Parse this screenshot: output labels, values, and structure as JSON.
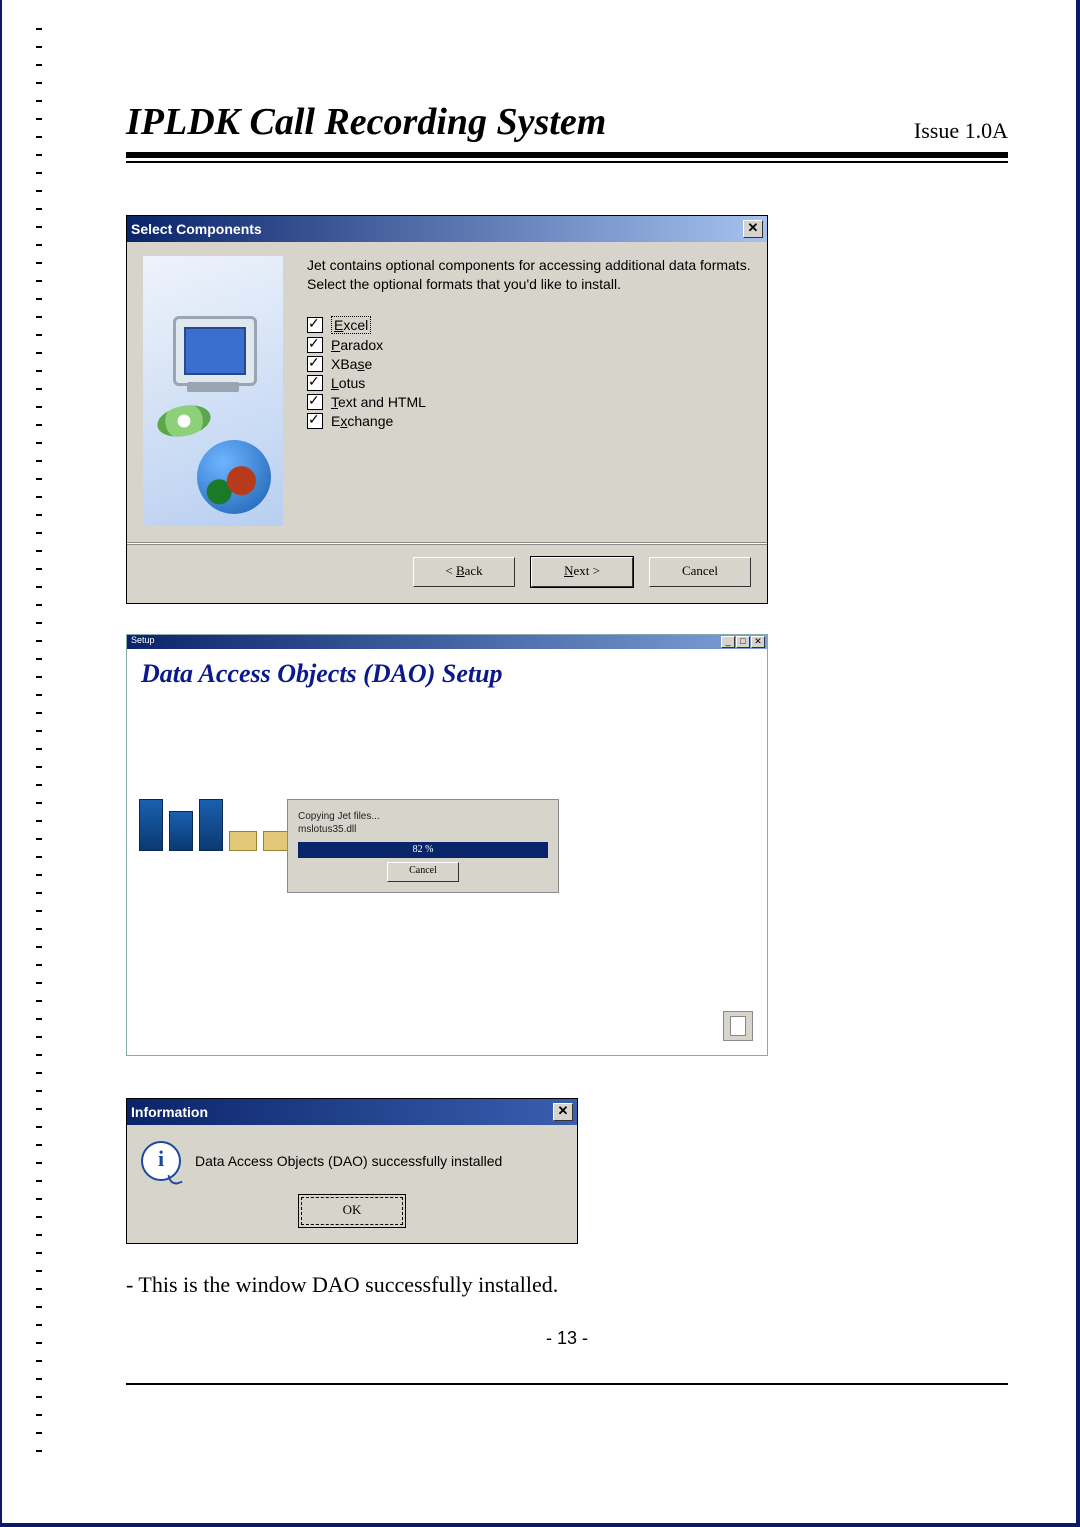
{
  "header": {
    "title": "IPLDK Call Recording System",
    "issue": "Issue 1.0A"
  },
  "dlg1": {
    "title": "Select Components",
    "close": "✕",
    "intro": "Jet contains optional components for accessing additional data formats. Select the optional formats that you'd like to install.",
    "options": {
      "excel": "Excel",
      "paradox": "Paradox",
      "xbase": "XBase",
      "lotus": "Lotus",
      "text": "Text and HTML",
      "exchange": "Exchange"
    },
    "buttons": {
      "back": "< Back",
      "next": "Next >",
      "cancel": "Cancel"
    }
  },
  "dlg2": {
    "mini": "Setup",
    "title": "Data Access Objects (DAO) Setup",
    "copy1": "Copying Jet files...",
    "copy2": "mslotus35.dll",
    "pct": "82 %",
    "cancel": "Cancel"
  },
  "dlg3": {
    "title": "Information",
    "close": "✕",
    "msg": "Data Access Objects (DAO) successfully installed",
    "ok": "OK"
  },
  "caption": "- This is the window DAO successfully installed.",
  "pagenum": "- 13 -"
}
